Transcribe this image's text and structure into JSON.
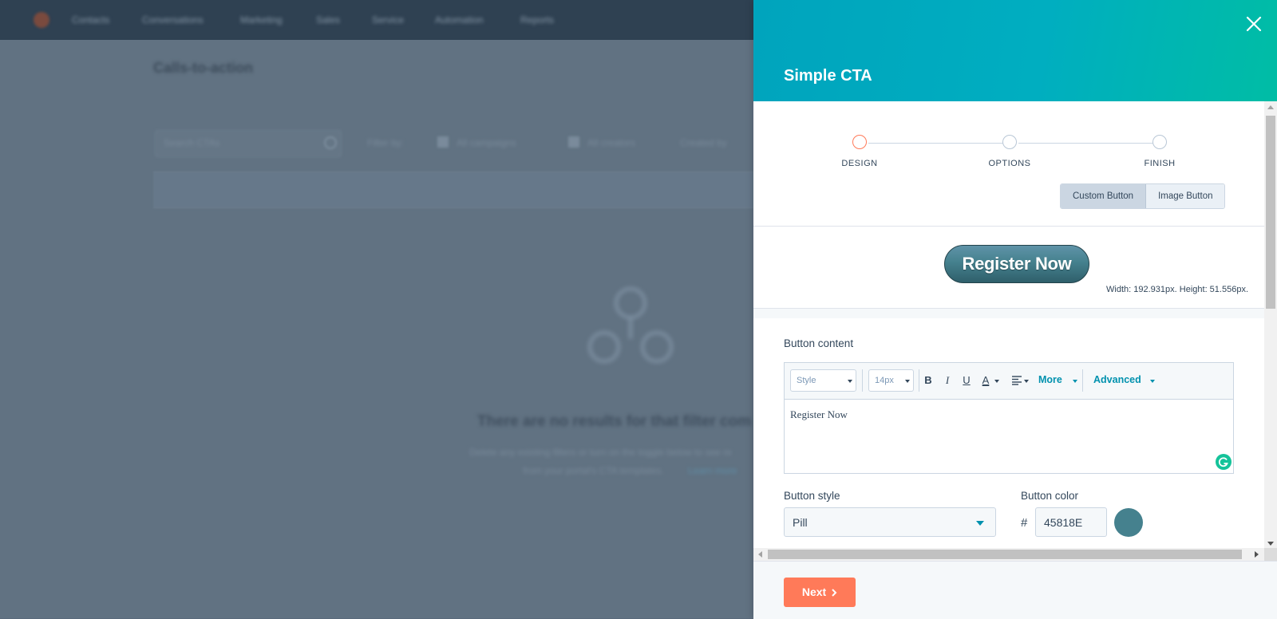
{
  "background": {
    "nav_items": [
      "Contacts",
      "Conversations",
      "Marketing",
      "Sales",
      "Service",
      "Automation",
      "Reports"
    ],
    "page_title": "Calls-to-action",
    "search_placeholder": "Search CTAs",
    "filters": {
      "label": "Filter by:",
      "item1": "All campaigns",
      "item2": "All creators",
      "item3": "Created by"
    },
    "empty_title": "There are no results for that filter com",
    "empty_sub1": "Delete any existing filters or turn on the toggle below to see re",
    "empty_sub2": "from your portal's CTA templates.",
    "empty_link": "Learn more"
  },
  "panel": {
    "title": "Simple CTA",
    "close_icon": "close-icon",
    "steps": [
      {
        "label": "DESIGN",
        "active": true
      },
      {
        "label": "OPTIONS",
        "active": false
      },
      {
        "label": "FINISH",
        "active": false
      }
    ],
    "toggle": {
      "custom": "Custom Button",
      "image": "Image Button",
      "selected": "custom"
    },
    "preview": {
      "button_text": "Register Now",
      "dimensions": "Width: 192.931px. Height: 51.556px."
    },
    "content": {
      "label": "Button content",
      "toolbar": {
        "style_label": "Style",
        "size_label": "14px",
        "bold": "B",
        "italic": "I",
        "underline": "U",
        "color": "A",
        "more": "More",
        "advanced": "Advanced"
      },
      "text": "Register Now"
    },
    "style": {
      "label": "Button style",
      "value": "Pill"
    },
    "color": {
      "label": "Button color",
      "hash": "#",
      "value": "45818E",
      "swatch": "#45818e"
    },
    "footer": {
      "next_label": "Next"
    }
  },
  "colors": {
    "accent": "#ff7a59",
    "header_start": "#00a4bd",
    "header_end": "#00bda5",
    "link": "#0091ae"
  }
}
